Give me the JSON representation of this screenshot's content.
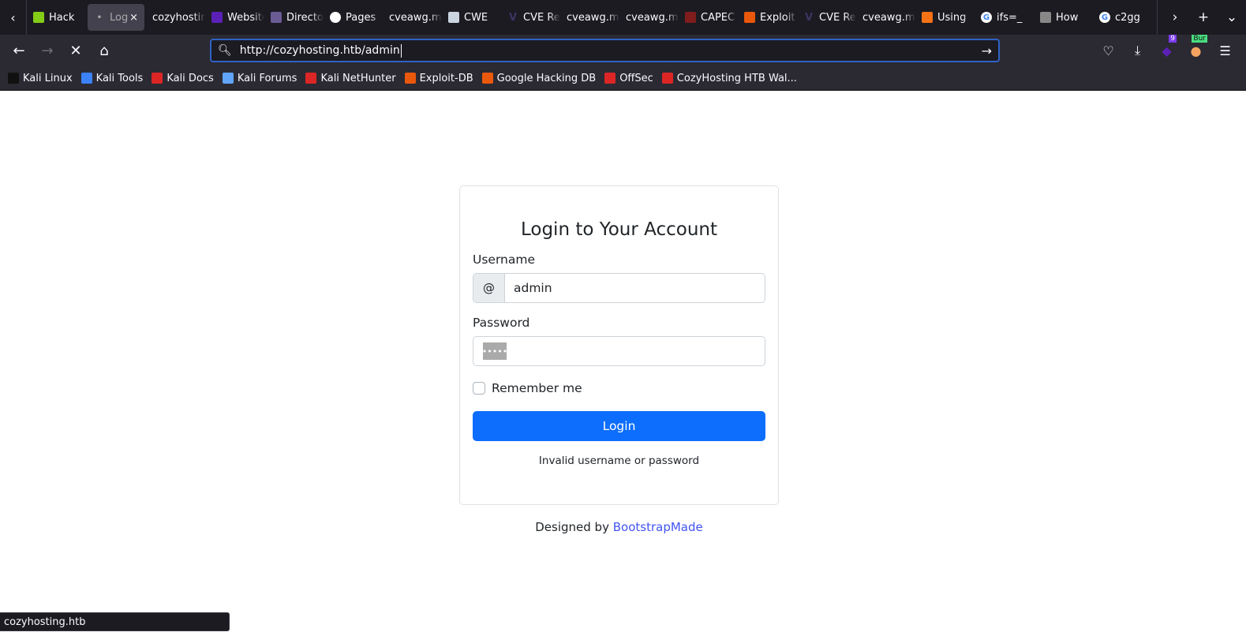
{
  "tabs": [
    {
      "label": "Hack",
      "icon": "cube-icon",
      "color": "#84cc16"
    },
    {
      "label": "Log",
      "icon": "loading-dot-icon",
      "color": "#42414d",
      "active": true
    },
    {
      "label": "cozyhosting",
      "icon": "",
      "color": ""
    },
    {
      "label": "Websites",
      "icon": "diamond-icon",
      "color": "#5b21b6"
    },
    {
      "label": "Directory",
      "icon": "mask-icon",
      "color": "#6b5b95"
    },
    {
      "label": "Pages",
      "icon": "github-icon",
      "color": "#ffffff"
    },
    {
      "label": "cveawg.mitre",
      "icon": "",
      "color": ""
    },
    {
      "label": "CWE",
      "icon": "cwe-icon",
      "color": "#cbd5e1"
    },
    {
      "label": "CVE Record",
      "icon": "cve-v-icon",
      "color": "#3b3563"
    },
    {
      "label": "cveawg.mitre",
      "icon": "",
      "color": ""
    },
    {
      "label": "cveawg.mitre",
      "icon": "",
      "color": ""
    },
    {
      "label": "CAPEC",
      "icon": "capec-icon",
      "color": "#7f1d1d"
    },
    {
      "label": "Exploit",
      "icon": "exploitdb-icon",
      "color": "#ea580c"
    },
    {
      "label": "CVE Record",
      "icon": "cve-v-icon",
      "color": "#3b3563"
    },
    {
      "label": "cveawg.mitre",
      "icon": "",
      "color": ""
    },
    {
      "label": "Using",
      "icon": "bolt-icon",
      "color": "#f97316"
    },
    {
      "label": "ifs=_",
      "icon": "google-icon",
      "color": "#ffffff"
    },
    {
      "label": "How",
      "icon": "bars-icon",
      "color": "#888888"
    },
    {
      "label": "c2gg",
      "icon": "google-icon",
      "color": "#ffffff"
    }
  ],
  "tab_close": "×",
  "url": "http://cozyhosting.htb/admin",
  "badges": {
    "extension_count": "9",
    "burp": "Bur"
  },
  "bookmarks": [
    {
      "label": "Kali Linux",
      "color": "#111111"
    },
    {
      "label": "Kali Tools",
      "color": "#3b82f6"
    },
    {
      "label": "Kali Docs",
      "color": "#dc2626"
    },
    {
      "label": "Kali Forums",
      "color": "#60a5fa"
    },
    {
      "label": "Kali NetHunter",
      "color": "#dc2626"
    },
    {
      "label": "Exploit-DB",
      "color": "#ea580c"
    },
    {
      "label": "Google Hacking DB",
      "color": "#ea580c"
    },
    {
      "label": "OffSec",
      "color": "#dc2626"
    },
    {
      "label": "CozyHosting HTB Wal...",
      "color": "#dc2626"
    }
  ],
  "login": {
    "title": "Login to Your Account",
    "username_label": "Username",
    "username_prefix": "@",
    "username_value": "admin",
    "password_label": "Password",
    "password_mask": "•••••",
    "remember_label": "Remember me",
    "remember_checked": false,
    "submit_label": "Login",
    "error": "Invalid username or password"
  },
  "credits": {
    "prefix": "Designed by ",
    "link": "BootstrapMade"
  },
  "status_text": "cozyhosting.htb",
  "colors": {
    "primary": "#0d6efd",
    "link": "#4154f1",
    "urlbar_focus": "#2f63c4"
  }
}
